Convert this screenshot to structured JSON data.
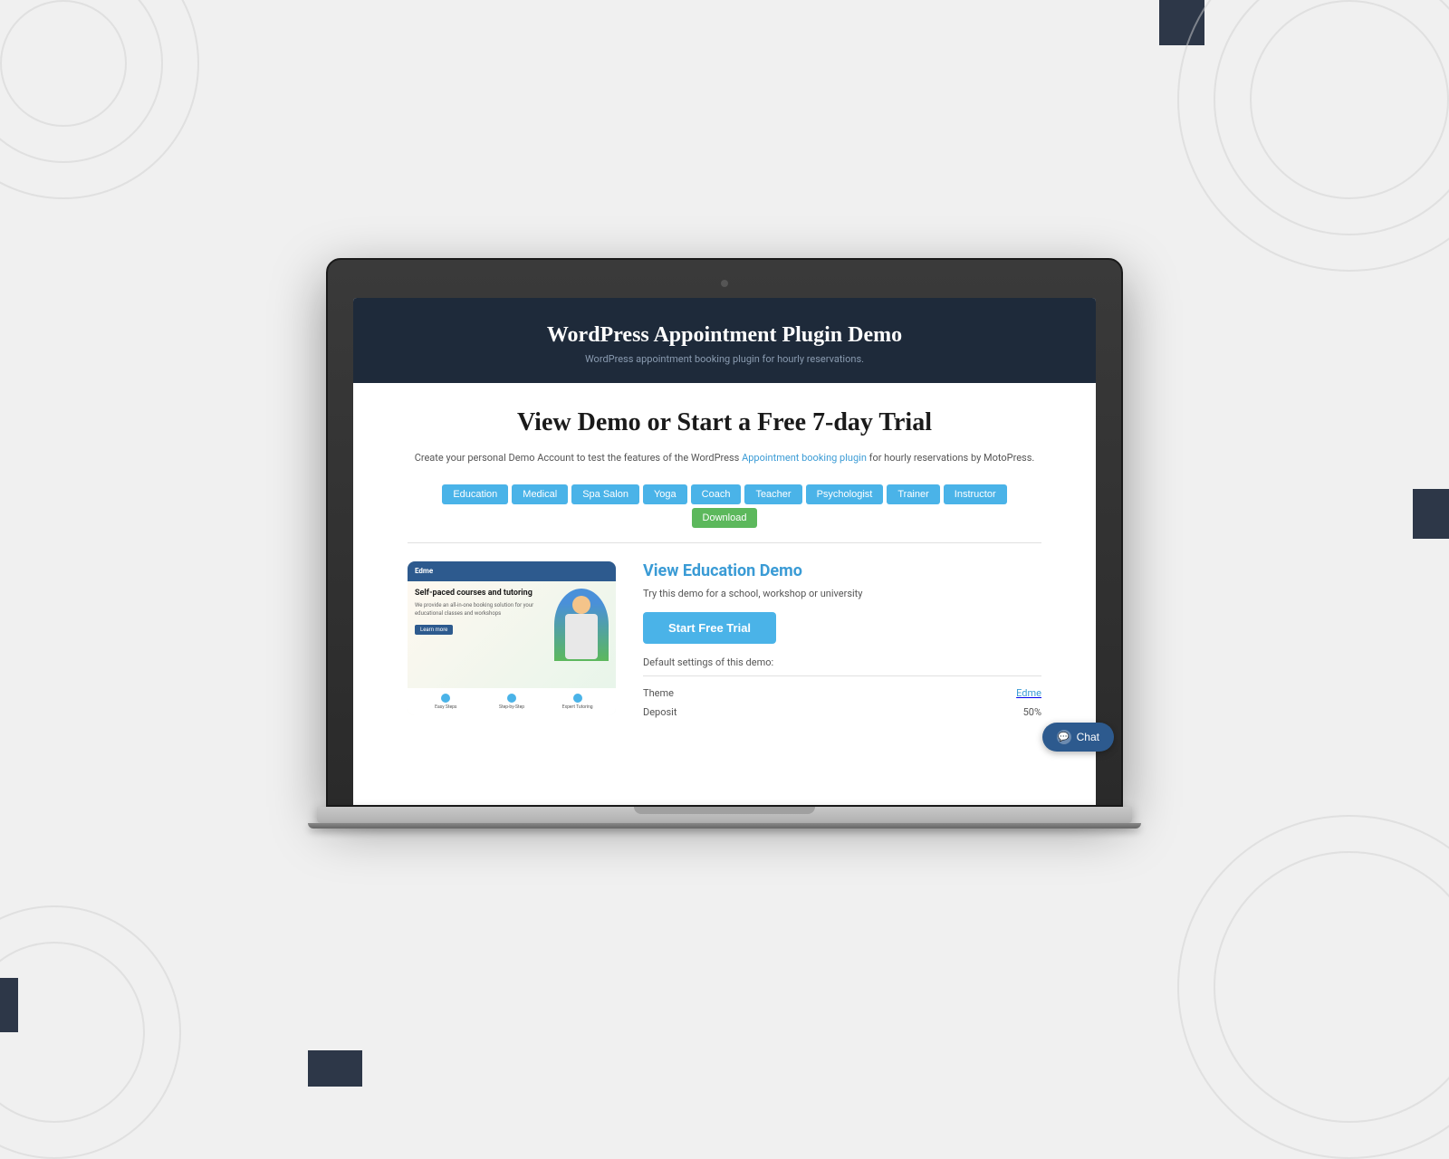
{
  "background": {
    "color": "#f0f0f0"
  },
  "laptop": {
    "header": {
      "title": "WordPress Appointment Plugin Demo",
      "subtitle": "WordPress appointment booking plugin for hourly reservations."
    },
    "main_heading": "View Demo or Start a Free 7-day Trial",
    "description": {
      "before_link": "Create your personal Demo Account to test the features of the WordPress ",
      "link_text": "Appointment booking plugin",
      "after_link": " for hourly reservations by MotoPress."
    },
    "tabs": [
      {
        "label": "Education",
        "style": "default"
      },
      {
        "label": "Medical",
        "style": "default"
      },
      {
        "label": "Spa Salon",
        "style": "default"
      },
      {
        "label": "Yoga",
        "style": "default"
      },
      {
        "label": "Coach",
        "style": "default"
      },
      {
        "label": "Teacher",
        "style": "default"
      },
      {
        "label": "Psychologist",
        "style": "default"
      },
      {
        "label": "Trainer",
        "style": "default"
      },
      {
        "label": "Instructor",
        "style": "default"
      },
      {
        "label": "Download",
        "style": "green"
      }
    ],
    "demo": {
      "image_logo": "Edme",
      "image_heading": "Self-paced courses and tutoring",
      "title": "View Education Demo",
      "description": "Try this demo for a school, workshop or university",
      "start_trial_label": "Start Free Trial",
      "default_settings_label": "Default settings of this demo:",
      "settings": [
        {
          "label": "Theme",
          "value": "Edme",
          "is_link": true
        },
        {
          "label": "Deposit",
          "value": "50%",
          "is_link": false
        }
      ]
    },
    "chat_button_label": "Chat"
  }
}
